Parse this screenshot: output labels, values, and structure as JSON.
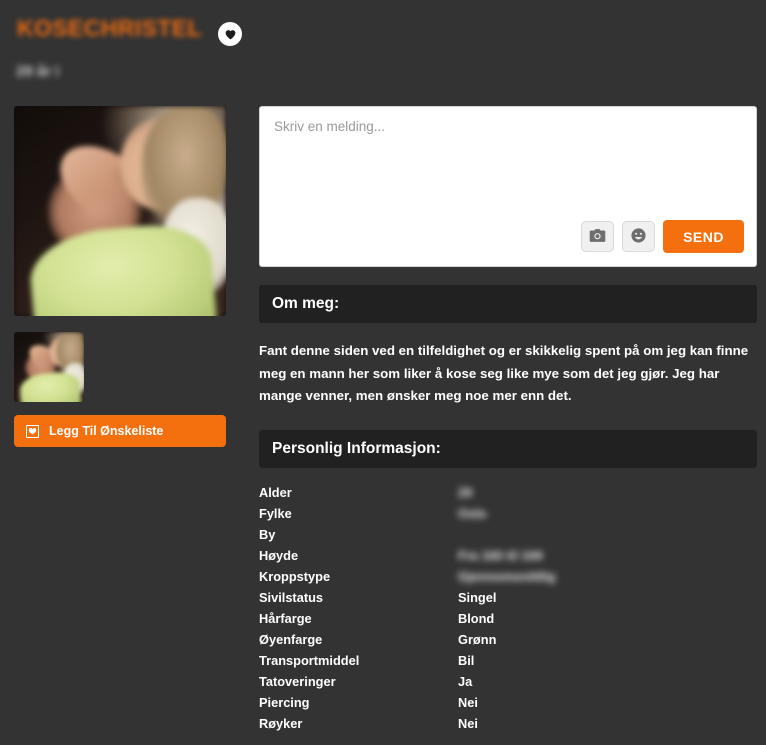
{
  "profile": {
    "username": "KOSECHRISTEL",
    "subtitle": "29 år i",
    "favorite_icon": "heart-icon",
    "accent_color": "#f4700f",
    "background_color": "#333333",
    "section_header_color": "#212121"
  },
  "gallery": {
    "main_photo_alt": "profile-photo",
    "thumbnails": [
      "profile-thumbnail-1"
    ]
  },
  "wishlist": {
    "label": "Legg Til Ønskeliste",
    "icon": "wishlist-icon"
  },
  "message": {
    "placeholder": "Skriv en melding...",
    "value": "",
    "camera_icon": "camera-icon",
    "emoji_icon": "smiley-icon",
    "send_label": "SEND"
  },
  "about": {
    "heading": "Om meg:",
    "body": "Fant denne siden ved en tilfeldighet og er skikkelig spent på om jeg kan finne meg en mann her som liker å kose seg like mye som det jeg gjør. Jeg har mange venner, men ønsker meg noe mer enn det."
  },
  "personal": {
    "heading": "Personlig Informasjon:",
    "rows": [
      {
        "label": "Alder",
        "value": "29",
        "redacted": true
      },
      {
        "label": "Fylke",
        "value": "Oslo",
        "redacted": true
      },
      {
        "label": "By",
        "value": "",
        "redacted": false
      },
      {
        "label": "Høyde",
        "value": "Fra 160 til 169",
        "redacted": true
      },
      {
        "label": "Kroppstype",
        "value": "Gjennomsnittlig",
        "redacted": true
      },
      {
        "label": "Sivilstatus",
        "value": "Singel",
        "redacted": false
      },
      {
        "label": "Hårfarge",
        "value": "Blond",
        "redacted": false
      },
      {
        "label": "Øyenfarge",
        "value": "Grønn",
        "redacted": false
      },
      {
        "label": "Transportmiddel",
        "value": "Bil",
        "redacted": false
      },
      {
        "label": "Tatoveringer",
        "value": "Ja",
        "redacted": false
      },
      {
        "label": "Piercing",
        "value": "Nei",
        "redacted": false
      },
      {
        "label": "Røyker",
        "value": "Nei",
        "redacted": false
      }
    ]
  }
}
